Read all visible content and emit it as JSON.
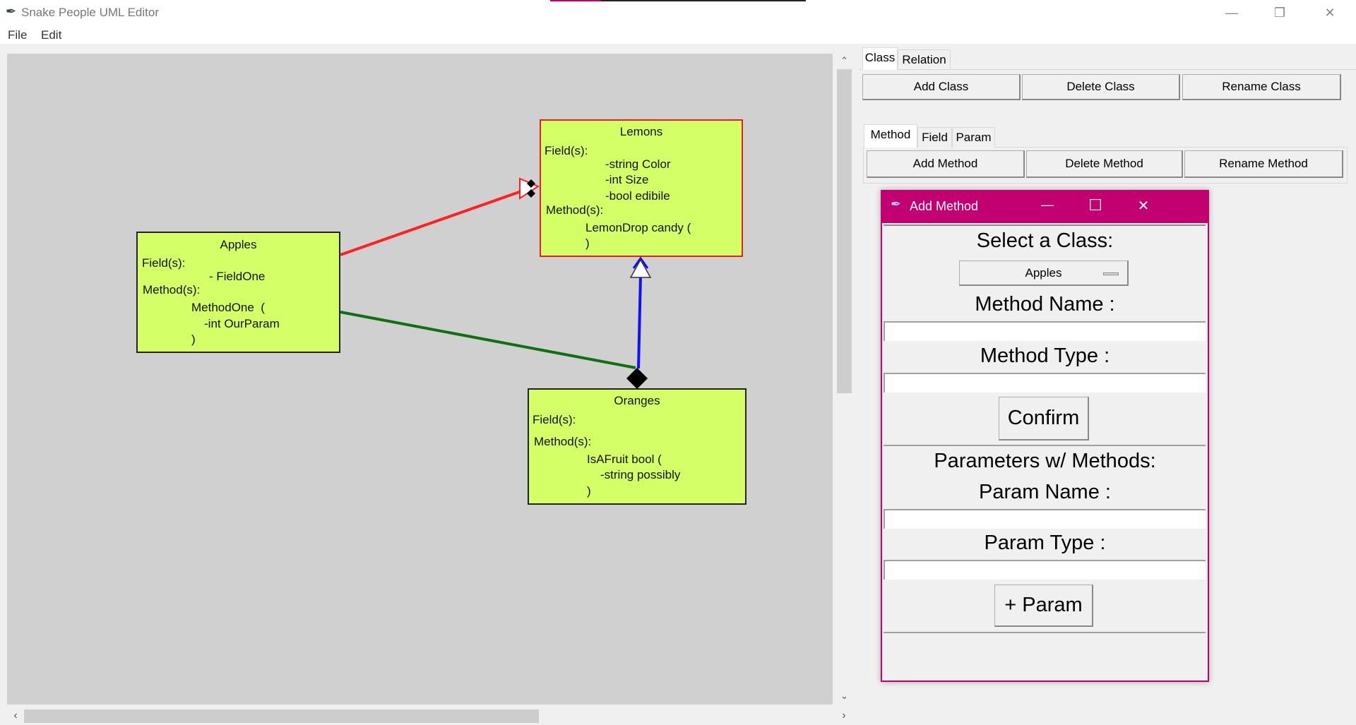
{
  "window": {
    "title": "Snake People UML Editor",
    "minimize": "—",
    "restore": "❐",
    "close": "✕"
  },
  "menu": [
    "File",
    "Edit"
  ],
  "canvas": {
    "classes": [
      {
        "name": "Lemons",
        "fields_label": "Field(s):",
        "fields": [
          "-string Color",
          "-int Size",
          "-bool edibile"
        ],
        "methods_label": "Method(s):",
        "methods": [
          {
            "sig": "LemonDrop candy (",
            "params": [],
            "close": ")"
          }
        ],
        "border": "#e02020"
      },
      {
        "name": "Apples",
        "fields_label": "Field(s):",
        "fields": [
          "- FieldOne"
        ],
        "methods_label": "Method(s):",
        "methods": [
          {
            "sig": "MethodOne  (",
            "params": [
              "-int OurParam"
            ],
            "close": ")"
          }
        ],
        "border": "#222222"
      },
      {
        "name": "Oranges",
        "fields_label": "Field(s):",
        "fields": [],
        "methods_label": "Method(s):",
        "methods": [
          {
            "sig": "IsAFruit bool (",
            "params": [
              "-string possibly"
            ],
            "close": ")"
          }
        ],
        "border": "#222222"
      }
    ],
    "relations": [
      {
        "from": "Apples",
        "to": "Lemons",
        "color": "#ff2020",
        "type": "inheritance"
      },
      {
        "from": "Apples",
        "to": "Oranges",
        "color": "#107010",
        "type": "composition"
      },
      {
        "from": "Oranges",
        "to": "Lemons",
        "color": "#1010ff",
        "type": "realization"
      }
    ]
  },
  "panel": {
    "tabs": [
      "Class",
      "Relation"
    ],
    "class_buttons": [
      "Add Class",
      "Delete Class",
      "Rename Class"
    ],
    "subtabs": [
      "Method",
      "Field",
      "Param"
    ],
    "method_buttons": [
      "Add Method",
      "Delete Method",
      "Rename Method"
    ]
  },
  "dialog": {
    "title": "Add Method",
    "minimize": "—",
    "maximize": "☐",
    "close": "✕",
    "select_label": "Select a Class:",
    "selected_class": "Apples",
    "method_name_label": "Method Name :",
    "method_name_value": "",
    "method_type_label": "Method Type :",
    "method_type_value": "",
    "confirm": "Confirm",
    "params_heading": "Parameters w/ Methods:",
    "param_name_label": "Param Name :",
    "param_name_value": "",
    "param_type_label": "Param Type :",
    "param_type_value": "",
    "add_param": "+ Param",
    "accent": "#c2006f"
  }
}
